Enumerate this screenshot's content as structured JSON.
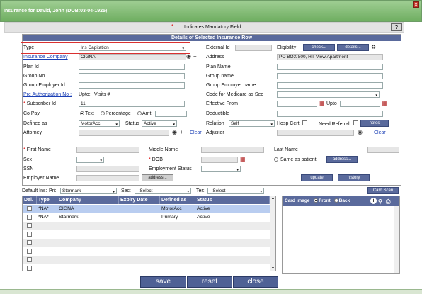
{
  "window": {
    "title": "Insurance for David, John (DOB:03-04-1925)",
    "close": "x"
  },
  "mandatory": {
    "star": "*",
    "text": "Indicates Mandatory Field",
    "help": "?"
  },
  "panel": {
    "title": "Details of Selected Insurance Row"
  },
  "form": {
    "type_label": "Type",
    "type_value": "Ins Capitation",
    "external_id_label": "External Id",
    "eligibility_label": "Eligibility",
    "check_btn": "check...",
    "details_btn": "details...",
    "insurance_company_label": "Insurance Company",
    "insurance_company_value": "CIGNA",
    "address_label": "Address",
    "address_value": "PO BOX 800,  Hill View Apartment",
    "plan_id_label": "Plan Id",
    "plan_name_label": "Plan Name",
    "group_no_label": "Group No.",
    "group_name_label": "Group name",
    "group_employer_id_label": "Group Employer Id",
    "group_employer_name_label": "Group Employer name",
    "pre_auth_label": "Pre Authorization No :",
    "upto_label": "Upto:",
    "visits_label": "Visits #",
    "medicare_label": "Code for Medicare as Sec",
    "subscriber_id_label": "Subscriber Id",
    "subscriber_id_value": "11",
    "effective_from_label": "Effective From",
    "upto2_label": "Upto",
    "copay_label": "Co Pay",
    "radio_text": "Text",
    "radio_percentage": "Percentage",
    "radio_amt": "Amt",
    "deductible_label": "Deductible",
    "defined_as_label": "Defined as",
    "defined_as_value": "MotorAcc",
    "status_label": "Status",
    "status_value": "Active",
    "relation_label": "Relation",
    "relation_value": "Self",
    "hosp_cert_label": "Hosp Cert",
    "need_referral_label": "Need Referral",
    "notes_btn": "notes",
    "attorney_label": "Attorney",
    "clear1": "Clear",
    "adjuster_label": "Adjuster",
    "clear2": "Clear",
    "first_name_label": "First Name",
    "middle_name_label": "Middle Name",
    "last_name_label": "Last Name",
    "sex_label": "Sex",
    "dob_label": "DOB",
    "same_as_patient_label": "Same as patient",
    "address_btn": "address...",
    "ssn_label": "SSN",
    "employment_status_label": "Employment Status",
    "employer_name_label": "Employer Name",
    "address_btn2": "address...",
    "update_btn": "update",
    "history_btn": "history"
  },
  "defaults": {
    "label": "Default Ins:",
    "pri_label": "Pri:",
    "pri_value": "Starmark",
    "sec_label": "Sec:",
    "sec_value": "--Select--",
    "ter_label": "Ter:",
    "ter_value": "--Select--"
  },
  "card_scan_btn": "Card Scan",
  "card": {
    "label": "Card Image",
    "front": "Front",
    "back": "Back"
  },
  "table": {
    "headers": [
      "Del.",
      "Type",
      "Company",
      "Expiry Date",
      "Defined as",
      "Status"
    ],
    "rows": [
      {
        "del": "",
        "type": "*NA*",
        "company": "CIGNA",
        "expiry": "",
        "defined": "MotorAcc",
        "status": "Active"
      },
      {
        "del": "",
        "type": "*NA*",
        "company": "Starmark",
        "expiry": "",
        "defined": "Primary",
        "status": "Active"
      }
    ]
  },
  "buttons": {
    "save": "save",
    "reset": "reset",
    "close": "close"
  },
  "colors": {
    "titlebar": "#7fbc72",
    "panel_header": "#5a6a9c",
    "selected_row": "#b9cdf0",
    "highlight_border": "#d93030"
  }
}
